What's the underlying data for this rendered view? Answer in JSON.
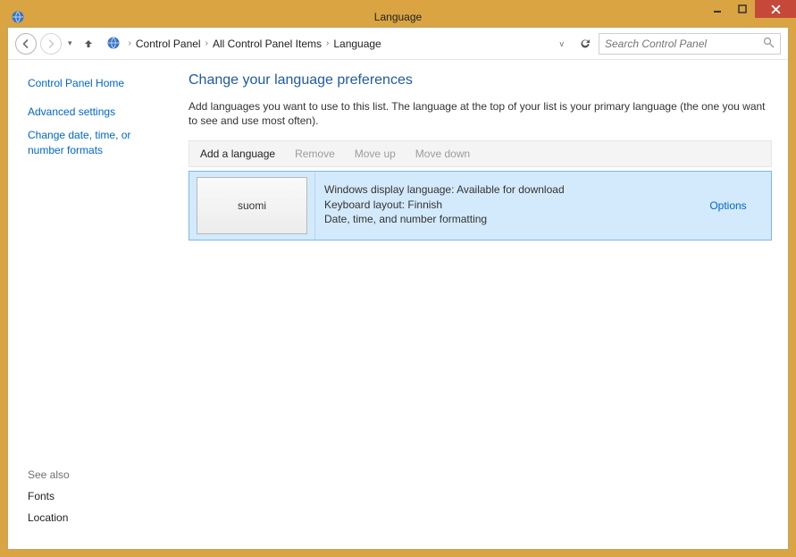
{
  "window": {
    "title": "Language"
  },
  "breadcrumb": {
    "items": [
      "Control Panel",
      "All Control Panel Items",
      "Language"
    ]
  },
  "search": {
    "placeholder": "Search Control Panel"
  },
  "sidebar": {
    "home": "Control Panel Home",
    "links": [
      "Advanced settings",
      "Change date, time, or number formats"
    ]
  },
  "see_also": {
    "title": "See also",
    "links": [
      "Fonts",
      "Location"
    ]
  },
  "main": {
    "heading": "Change your language preferences",
    "description": "Add languages you want to use to this list. The language at the top of your list is your primary language (the one you want to see and use most often)."
  },
  "commands": {
    "add": "Add a language",
    "remove": "Remove",
    "moveup": "Move up",
    "movedown": "Move down"
  },
  "languages": [
    {
      "name": "suomi",
      "detail1": "Windows display language: Available for download",
      "detail2": "Keyboard layout: Finnish",
      "detail3": "Date, time, and number formatting",
      "options_label": "Options"
    }
  ]
}
